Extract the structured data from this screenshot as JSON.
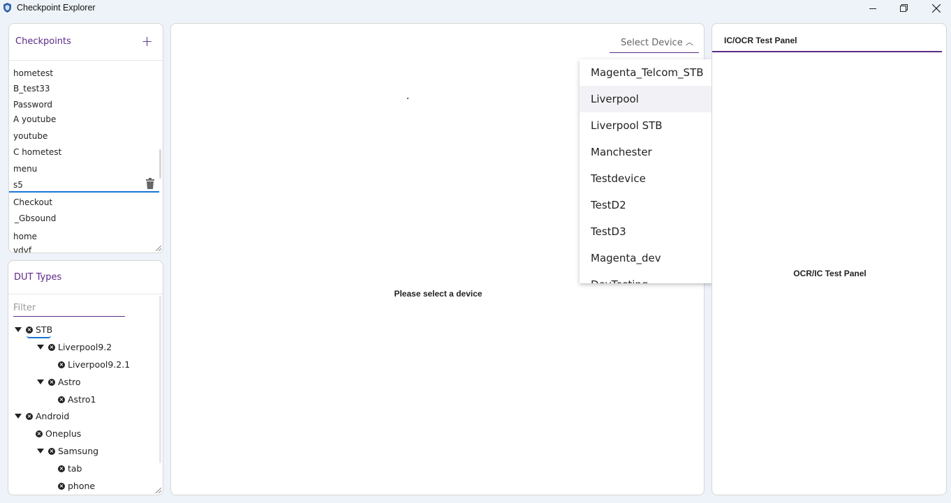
{
  "window": {
    "title": "Checkpoint Explorer"
  },
  "checkpoints": {
    "title": "Checkpoints",
    "add_label": "+",
    "items": [
      "hometest",
      "B_test33",
      "Password",
      "A youtube",
      "youtube",
      "C hometest",
      "menu",
      "s5",
      "Checkout",
      "_Gbsound",
      "home",
      "vdvf"
    ],
    "selected": "s5"
  },
  "dut": {
    "title": "DUT Types",
    "filter_placeholder": "Filter",
    "tree": {
      "stb": "STB",
      "liverpool92": "Liverpool9.2",
      "liverpool921": "Liverpool9.2.1",
      "astro": "Astro",
      "astro1": "Astro1",
      "android": "Android",
      "oneplus": "Oneplus",
      "samsung": "Samsung",
      "tab": "tab",
      "phone": "phone"
    }
  },
  "center": {
    "select_label": "Select Device",
    "placeholder": "Please select a device"
  },
  "dropdown": {
    "options": [
      "Magenta_Telcom_STB",
      "Liverpool",
      "Liverpool STB",
      "Manchester",
      "Testdevice",
      "TestD2",
      "TestD3",
      "Magenta_dev",
      "DevTesting"
    ],
    "hovered": "Liverpool"
  },
  "right_panel": {
    "title": "IC/OCR Test Panel",
    "center_text": "OCR/IC Test Panel"
  },
  "colors": {
    "accent": "#5b2a86",
    "focus": "#1976d2"
  }
}
